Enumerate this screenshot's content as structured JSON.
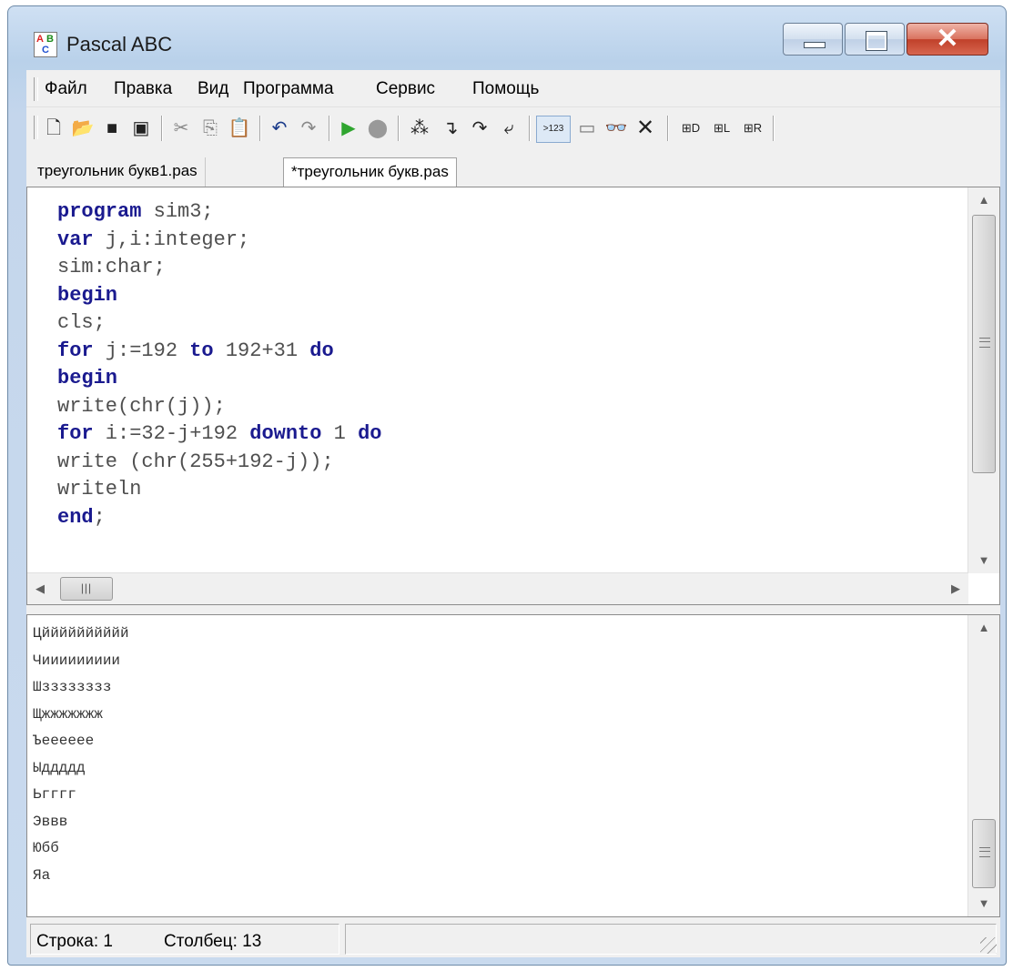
{
  "window": {
    "title": "Pascal ABC",
    "icon_letters": [
      "A",
      "B",
      "C"
    ]
  },
  "menu": [
    "Файл",
    "Правка",
    "Вид",
    "Программа",
    "Сервис",
    "Помощь"
  ],
  "toolbar": {
    "groups": [
      [
        "new-icon",
        "open-icon",
        "save-icon",
        "save-all-icon"
      ],
      [
        "cut-icon",
        "copy-icon",
        "paste-icon"
      ],
      [
        "undo-icon",
        "redo-icon"
      ],
      [
        "run-icon",
        "stop-icon"
      ],
      [
        "step-icon",
        "step-into-icon",
        "step-over-icon",
        "run-to-cursor-icon"
      ],
      [
        "watch-icon",
        "window-icon",
        "glasses-icon",
        "delete-icon"
      ],
      [
        "format-d-icon",
        "format-l-icon",
        "format-r-icon"
      ]
    ],
    "watch_label": ">123"
  },
  "tabs": [
    {
      "label": "треугольник букв1.pas",
      "active": false
    },
    {
      "label": "*треугольник букв.pas",
      "active": true
    }
  ],
  "code": [
    [
      {
        "t": "program",
        "k": true
      },
      {
        "t": " sim3;"
      }
    ],
    [
      {
        "t": "var",
        "k": true
      },
      {
        "t": " j,i:integer;"
      }
    ],
    [
      {
        "t": "sim:char;"
      }
    ],
    [
      {
        "t": "begin",
        "k": true
      }
    ],
    [
      {
        "t": "cls;"
      }
    ],
    [
      {
        "t": "for",
        "k": true
      },
      {
        "t": " j:=192 "
      },
      {
        "t": "to",
        "k": true
      },
      {
        "t": " 192+31 "
      },
      {
        "t": "do",
        "k": true
      }
    ],
    [
      {
        "t": "begin",
        "k": true
      }
    ],
    [
      {
        "t": "write(chr(j));"
      }
    ],
    [
      {
        "t": "for",
        "k": true
      },
      {
        "t": " i:=32-j+192 "
      },
      {
        "t": "downto",
        "k": true
      },
      {
        "t": " 1 "
      },
      {
        "t": "do",
        "k": true
      }
    ],
    [
      {
        "t": "write (chr(255+192-j));"
      }
    ],
    [
      {
        "t": "writeln"
      }
    ],
    [
      {
        "t": "end",
        "k": true
      },
      {
        "t": ";"
      }
    ]
  ],
  "output": [
    "Цйййййййййй",
    "Чиииииииии",
    "Шзззззззз",
    "Щжжжжжжж",
    "Ъееееее",
    "Ыддддд",
    "Ьгггг",
    "Эввв",
    "Юбб",
    "Яа"
  ],
  "statusbar": {
    "line": "Строка: 1",
    "column": "Столбец: 13"
  },
  "colors": {
    "keyword": "#1a1a8f",
    "code_text": "#4f4f4f",
    "close_button": "#c0402a"
  }
}
